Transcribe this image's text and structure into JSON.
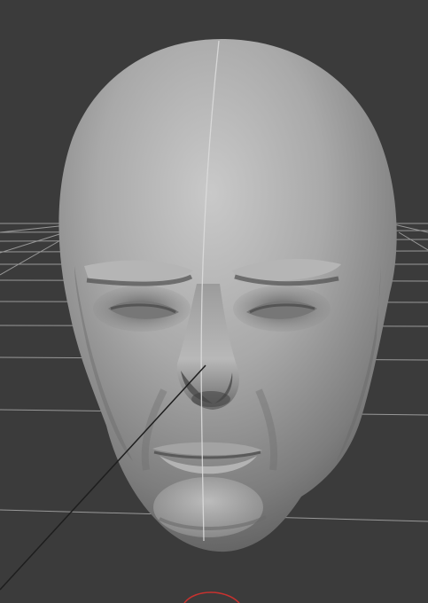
{
  "viewport": {
    "background_color": "#3b3b3b",
    "grid_color": "#b8b8b8",
    "mesh_base_color": "#8f8f8f",
    "mesh_highlight_color": "#d0d0d0",
    "mesh_shadow_color": "#4a4a4a",
    "symmetry_line_color": "#d8d8d8",
    "gizmo_color": "#c8322f"
  },
  "scene": {
    "object": "sculpted-head-mesh",
    "grid_visible": true,
    "symmetry_line_visible": true
  }
}
